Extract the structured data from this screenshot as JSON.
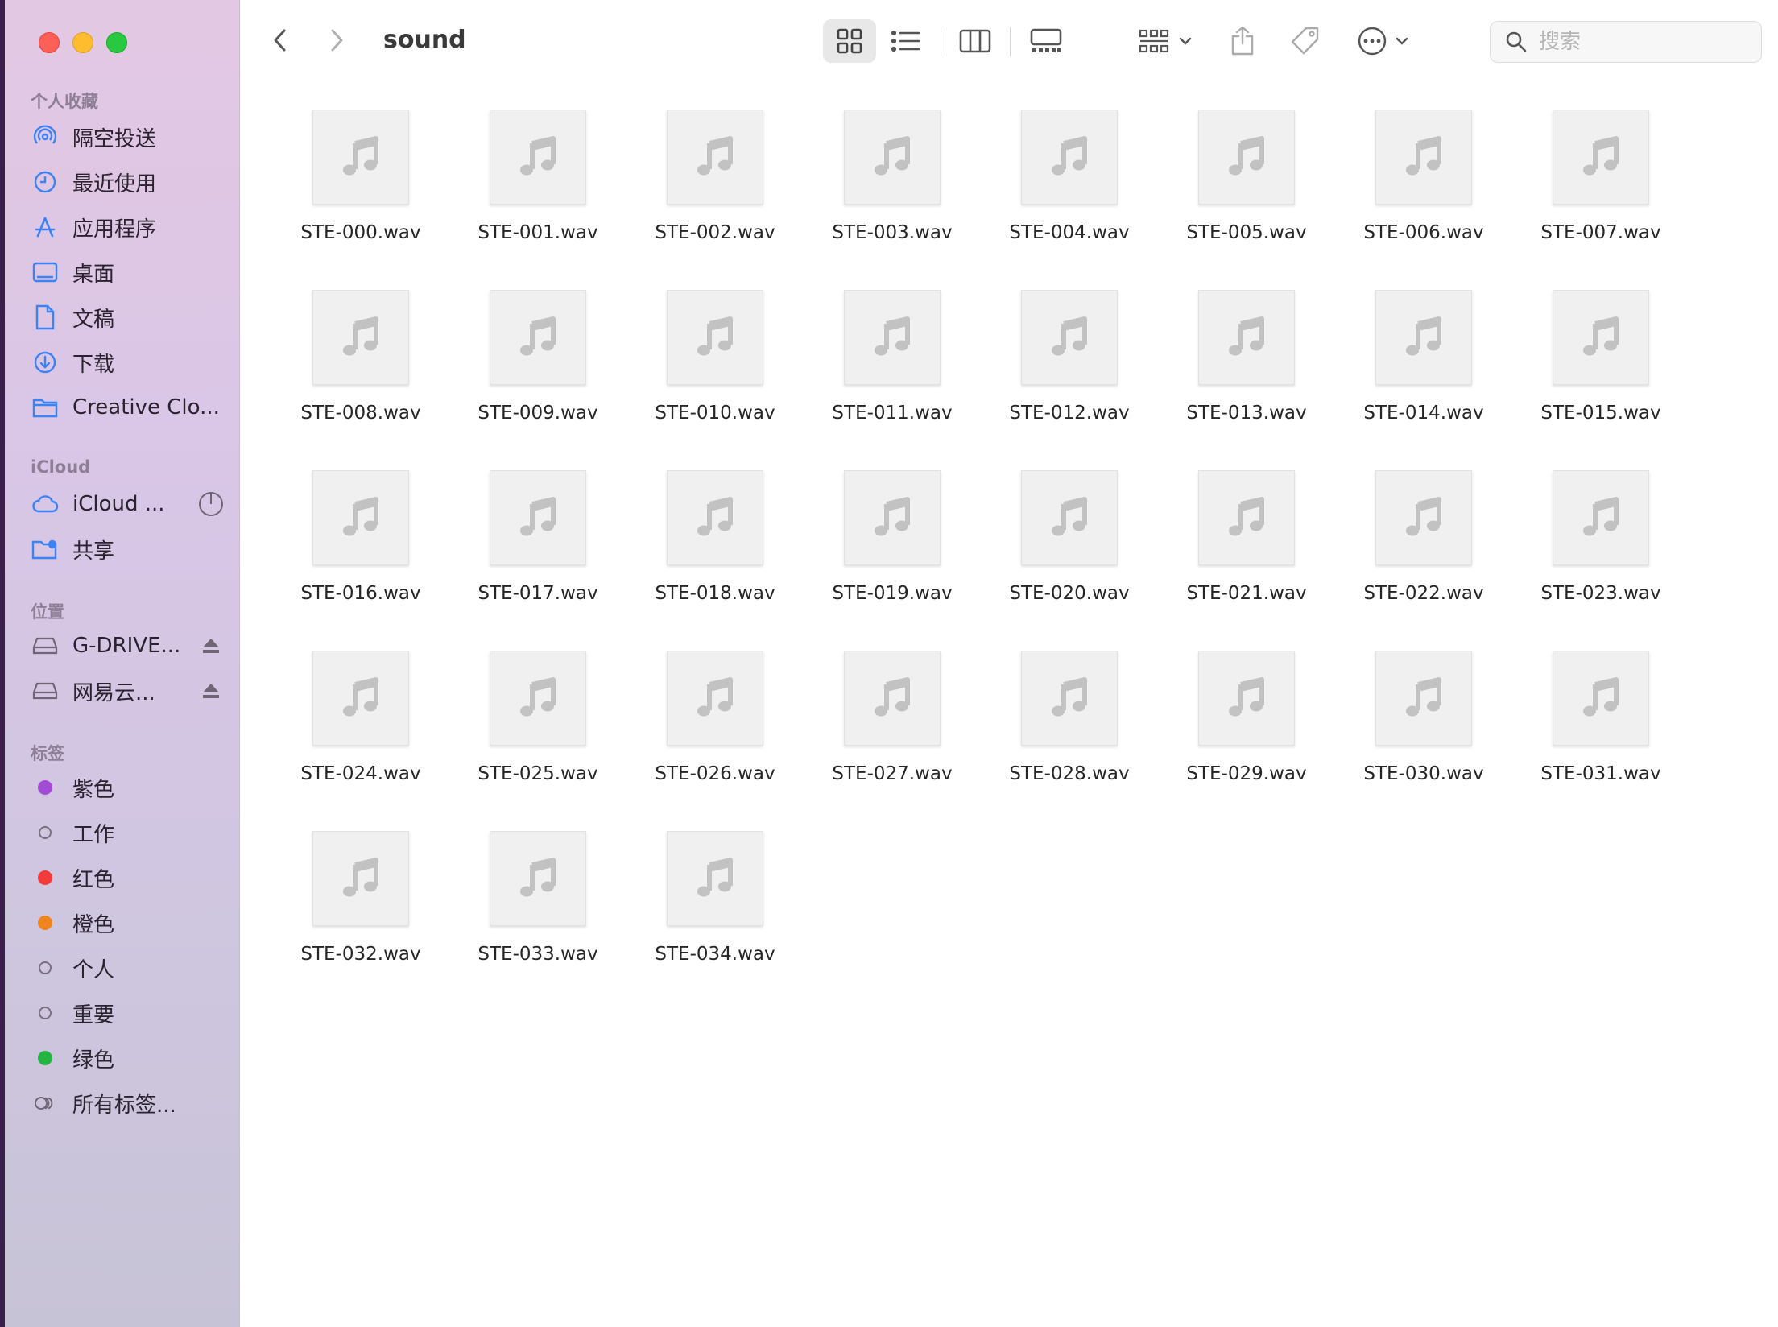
{
  "window": {
    "folder_title": "sound"
  },
  "sidebar": {
    "favorites_title": "个人收藏",
    "favorites": [
      {
        "label": "隔空投送",
        "icon": "airdrop-icon"
      },
      {
        "label": "最近使用",
        "icon": "clock-icon"
      },
      {
        "label": "应用程序",
        "icon": "applications-icon"
      },
      {
        "label": "桌面",
        "icon": "desktop-icon"
      },
      {
        "label": "文稿",
        "icon": "document-icon"
      },
      {
        "label": "下载",
        "icon": "download-icon"
      },
      {
        "label": "Creative Clo...",
        "icon": "folder-icon"
      }
    ],
    "icloud_title": "iCloud",
    "icloud": [
      {
        "label": "iCloud ...",
        "icon": "cloud-icon"
      },
      {
        "label": "共享",
        "icon": "shared-folder-icon"
      }
    ],
    "locations_title": "位置",
    "locations": [
      {
        "label": "G-DRIVE...",
        "icon": "drive-icon"
      },
      {
        "label": "网易云...",
        "icon": "drive-icon"
      }
    ],
    "tags_title": "标签",
    "tags": [
      {
        "label": "紫色",
        "color": "#a24cd6"
      },
      {
        "label": "工作",
        "color": ""
      },
      {
        "label": "红色",
        "color": "#f23b3b"
      },
      {
        "label": "橙色",
        "color": "#f0851f"
      },
      {
        "label": "个人",
        "color": ""
      },
      {
        "label": "重要",
        "color": ""
      },
      {
        "label": "绿色",
        "color": "#23b441"
      },
      {
        "label": "所有标签...",
        "color": "all"
      }
    ]
  },
  "toolbar": {
    "search_placeholder": "搜索"
  },
  "files": [
    "STE-000.wav",
    "STE-001.wav",
    "STE-002.wav",
    "STE-003.wav",
    "STE-004.wav",
    "STE-005.wav",
    "STE-006.wav",
    "STE-007.wav",
    "STE-008.wav",
    "STE-009.wav",
    "STE-010.wav",
    "STE-011.wav",
    "STE-012.wav",
    "STE-013.wav",
    "STE-014.wav",
    "STE-015.wav",
    "STE-016.wav",
    "STE-017.wav",
    "STE-018.wav",
    "STE-019.wav",
    "STE-020.wav",
    "STE-021.wav",
    "STE-022.wav",
    "STE-023.wav",
    "STE-024.wav",
    "STE-025.wav",
    "STE-026.wav",
    "STE-027.wav",
    "STE-028.wav",
    "STE-029.wav",
    "STE-030.wav",
    "STE-031.wav",
    "STE-032.wav",
    "STE-033.wav",
    "STE-034.wav"
  ],
  "colors": {
    "accent": "#3b82f6",
    "sidebar_icon": "#3b82f6"
  }
}
